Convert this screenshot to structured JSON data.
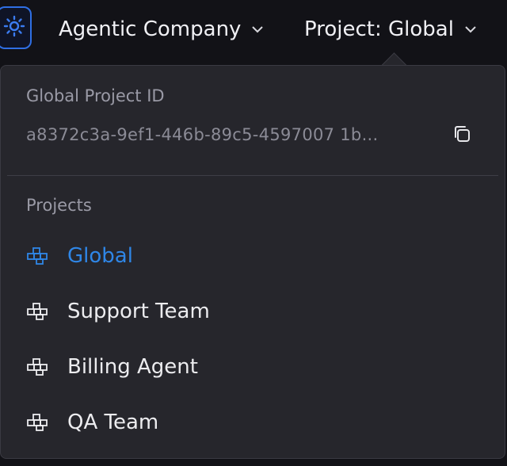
{
  "topbar": {
    "logo_icon": "sun-gear-icon",
    "company_label": "Agentic Company",
    "project_label": "Project: Global"
  },
  "dropdown": {
    "project_id_label": "Global Project ID",
    "project_id_value": "a8372c3a-9ef1-446b-89c5-4597007 1b...",
    "copy_icon": "copy-icon",
    "projects_label": "Projects",
    "items": [
      {
        "label": "Global",
        "active": true
      },
      {
        "label": "Support Team",
        "active": false
      },
      {
        "label": "Billing Agent",
        "active": false
      },
      {
        "label": "QA Team",
        "active": false
      }
    ]
  },
  "colors": {
    "accent": "#2f86e6",
    "logo_border": "#2f6fe4",
    "panel_bg": "#26262c"
  }
}
